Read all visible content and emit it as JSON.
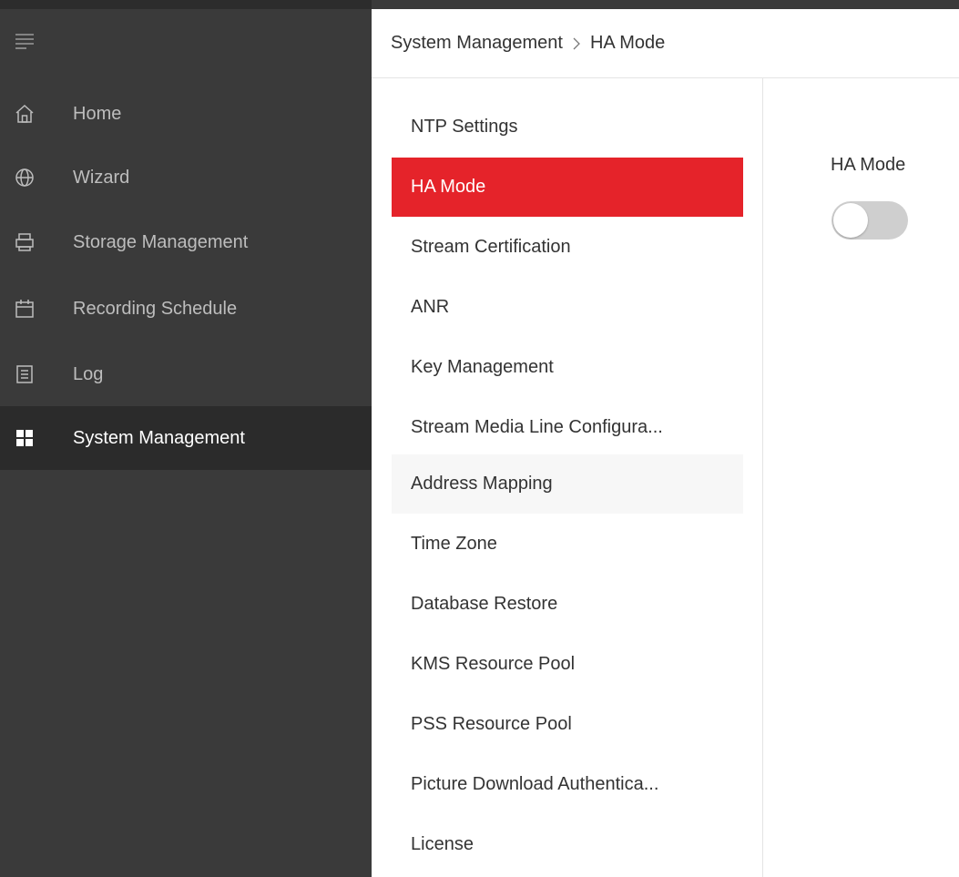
{
  "header": {
    "breadcrumb_root": "System Management",
    "breadcrumb_current": "HA Mode"
  },
  "sidebar": {
    "items": [
      {
        "label": "Home",
        "icon": "home-icon",
        "active": false
      },
      {
        "label": "Wizard",
        "icon": "globe-icon",
        "active": false
      },
      {
        "label": "Storage Management",
        "icon": "storage-icon",
        "active": false
      },
      {
        "label": "Recording Schedule",
        "icon": "calendar-icon",
        "active": false
      },
      {
        "label": "Log",
        "icon": "log-icon",
        "active": false
      },
      {
        "label": "System Management",
        "icon": "grid-icon",
        "active": true
      }
    ]
  },
  "submenu": {
    "items": [
      {
        "label": "NTP Settings",
        "active": false
      },
      {
        "label": "HA Mode",
        "active": true
      },
      {
        "label": "Stream Certification",
        "active": false
      },
      {
        "label": "ANR",
        "active": false
      },
      {
        "label": "Key Management",
        "active": false
      },
      {
        "label": "Stream Media Line Configura...",
        "active": false
      },
      {
        "label": "Address Mapping",
        "active": false,
        "hover": true
      },
      {
        "label": "Time Zone",
        "active": false
      },
      {
        "label": "Database Restore",
        "active": false
      },
      {
        "label": "KMS Resource Pool",
        "active": false
      },
      {
        "label": "PSS Resource Pool",
        "active": false
      },
      {
        "label": "Picture Download Authentica...",
        "active": false
      },
      {
        "label": "License",
        "active": false
      }
    ]
  },
  "content": {
    "ha_mode_label": "HA Mode",
    "ha_mode_enabled": false
  },
  "colors": {
    "sidebar_bg": "#3a3a3a",
    "sidebar_active_bg": "#2b2b2b",
    "accent_red": "#e5232a",
    "toggle_off": "#cfcfcf"
  }
}
